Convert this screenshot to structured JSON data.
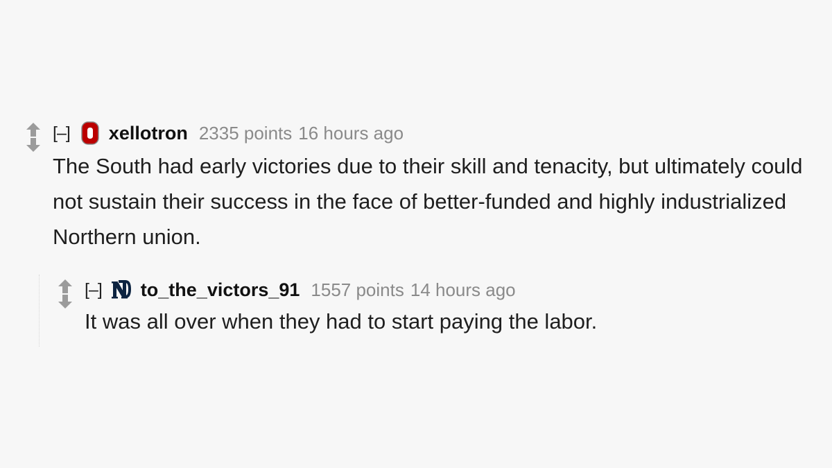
{
  "comments": [
    {
      "collapse_label": "[–]",
      "flair_icon": "ohio-state-block-o-icon",
      "author": "xellotron",
      "score": "2335 points",
      "time": "16 hours ago",
      "body": "The South had early victories due to their skill and tenacity, but ultimately could not sustain their success in the face of better-funded and highly industrialized Northern union."
    },
    {
      "collapse_label": "[–]",
      "flair_icon": "notre-dame-nd-icon",
      "author": "to_the_victors_91",
      "score": "1557 points",
      "time": "14 hours ago",
      "body": "It was all over when they had to start paying the labor."
    }
  ],
  "colors": {
    "background": "#f7f7f7",
    "arrow": "#9b9b9b",
    "flair_red": "#bb0000",
    "flair_navy": "#0c2340",
    "meta_text": "#8a8a8a"
  }
}
